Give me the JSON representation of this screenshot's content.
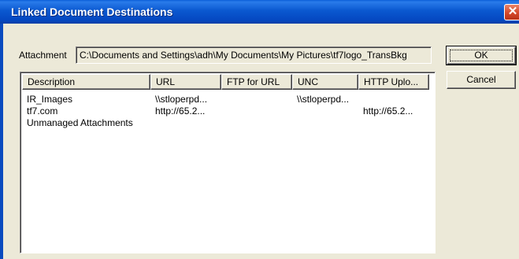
{
  "window": {
    "title": "Linked Document Destinations",
    "close_glyph": "✕"
  },
  "attachment": {
    "label": "Attachment",
    "value": "C:\\Documents and Settings\\adh\\My Documents\\My Pictures\\tf7logo_TransBkg"
  },
  "buttons": {
    "ok": "OK",
    "cancel": "Cancel"
  },
  "list": {
    "columns": [
      "Description",
      "URL",
      "FTP for URL",
      "UNC",
      "HTTP Uplo..."
    ],
    "rows": [
      [
        "IR_Images",
        "\\\\stloperpd...",
        "",
        "\\\\stloperpd...",
        ""
      ],
      [
        "tf7.com",
        "http://65.2...",
        "",
        "",
        "http://65.2..."
      ],
      [
        "Unmanaged Attachments",
        "",
        "",
        "",
        ""
      ]
    ]
  }
}
